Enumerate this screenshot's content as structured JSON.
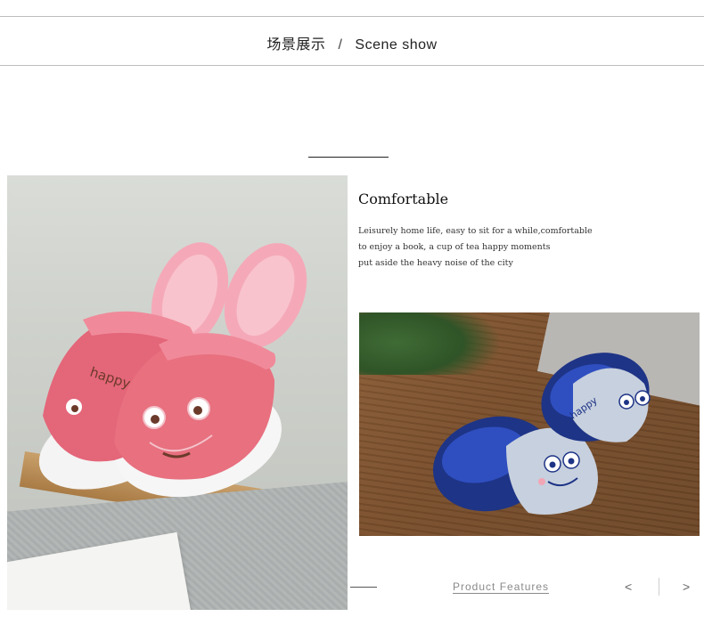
{
  "header": {
    "title_cn": "场景展示",
    "separator": "/",
    "title_en": "Scene show"
  },
  "content": {
    "heading": "Comfortable",
    "lines": [
      "Leisurely home life, easy to sit for a while,comfortable",
      "to enjoy a book, a cup of tea happy moments",
      "put aside the heavy noise of the city"
    ]
  },
  "images": {
    "left_photo": {
      "embroidery_text": "happy"
    },
    "right_photo": {
      "embroidery_text": "happy"
    }
  },
  "footer": {
    "features_link": "Product Features",
    "prev_icon": "<",
    "next_icon": ">"
  },
  "colors": {
    "pink_slipper": "#e8707f",
    "navy_slipper": "#1f3a8a",
    "rule": "#bdbdbd"
  }
}
